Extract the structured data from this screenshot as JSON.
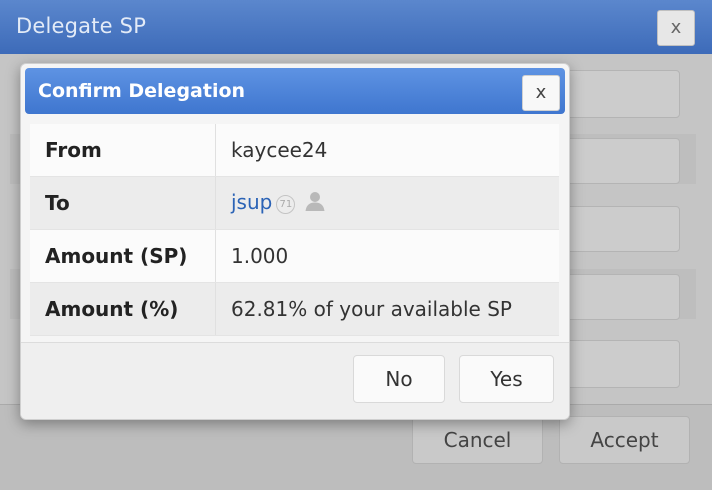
{
  "background_dialog": {
    "title": "Delegate SP",
    "close_label": "x",
    "cancel_label": "Cancel",
    "accept_label": "Accept"
  },
  "confirm_dialog": {
    "title": "Confirm Delegation",
    "close_label": "x",
    "rows": [
      {
        "label": "From",
        "value": "kaycee24"
      },
      {
        "label": "To",
        "value": "jsup",
        "reputation": "71",
        "icon": "person-icon"
      },
      {
        "label": "Amount (SP)",
        "value": "1.000"
      },
      {
        "label": "Amount (%)",
        "value": "62.81% of your available SP"
      }
    ],
    "no_label": "No",
    "yes_label": "Yes"
  },
  "colors": {
    "header_blue": "#3f76cf",
    "link_blue": "#2b63b6",
    "overlay_gray": "#c5c5c5"
  }
}
